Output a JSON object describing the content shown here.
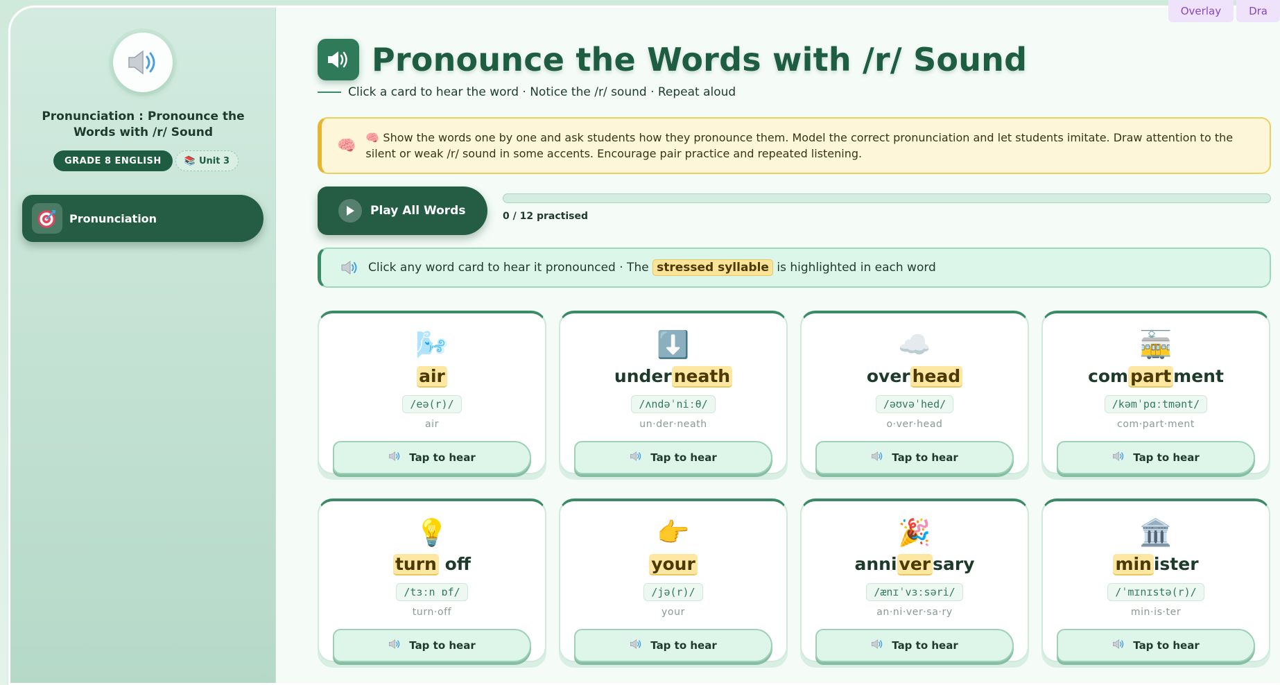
{
  "sidebar": {
    "title": "Pronunciation : Pronounce the Words with /r/ Sound",
    "grade_badge": "GRADE 8 ENGLISH",
    "unit_badge": "Unit 3",
    "nav_item": "Pronunciation"
  },
  "header": {
    "title": "Pronounce the Words with /r/ Sound",
    "subtitle": "Click a card to hear the word · Notice the /r/ sound · Repeat aloud"
  },
  "teacher_note": {
    "text": "🧠 Show the words one by one and ask students how they pronounce them. Model the correct pronunciation and let students imitate. Draw attention to the silent or weak /r/ sound in some accents. Encourage pair practice and repeated listening."
  },
  "play_all": {
    "label": "Play All Words"
  },
  "progress": {
    "label": "0 / 12 practised",
    "practised": 0,
    "total": 12
  },
  "tip": {
    "before": "Click any word card to hear it pronounced · The",
    "highlight": "stressed syllable",
    "after": "is highlighted in each word"
  },
  "cards": [
    {
      "emoji": "🌬️",
      "pre": "",
      "stress": "air",
      "post": "",
      "ipa": "/eə(r)/",
      "syllables": "air",
      "button": "Tap to hear"
    },
    {
      "emoji": "⬇️",
      "pre": "under",
      "stress": "neath",
      "post": "",
      "ipa": "/ʌndəˈniːθ/",
      "syllables": "un·der·neath",
      "button": "Tap to hear"
    },
    {
      "emoji": "☁️",
      "pre": "over",
      "stress": "head",
      "post": "",
      "ipa": "/əʊvəˈhed/",
      "syllables": "o·ver·head",
      "button": "Tap to hear"
    },
    {
      "emoji": "🚋",
      "pre": "com",
      "stress": "part",
      "post": "ment",
      "ipa": "/kəmˈpɑːtmənt/",
      "syllables": "com·part·ment",
      "button": "Tap to hear"
    },
    {
      "emoji": "💡",
      "pre": "",
      "stress": "turn",
      "post": " off",
      "ipa": "/tɜːn ɒf/",
      "syllables": "turn·off",
      "button": "Tap to hear"
    },
    {
      "emoji": "👉",
      "pre": "",
      "stress": "your",
      "post": "",
      "ipa": "/jə(r)/",
      "syllables": "your",
      "button": "Tap to hear"
    },
    {
      "emoji": "🎉",
      "pre": "anni",
      "stress": "ver",
      "post": "sary",
      "ipa": "/ænɪˈvɜːsəri/",
      "syllables": "an·ni·ver·sa·ry",
      "button": "Tap to hear"
    },
    {
      "emoji": "🏛️",
      "pre": "",
      "stress": "min",
      "post": "ister",
      "ipa": "/ˈmɪnɪstə(r)/",
      "syllables": "min·is·ter",
      "button": "Tap to hear"
    }
  ],
  "overlay_tabs": [
    "Overlay",
    "Dra"
  ],
  "colors": {
    "accent": "#245d44",
    "highlight": "#fde7a3",
    "note_border": "#efcf5b"
  }
}
